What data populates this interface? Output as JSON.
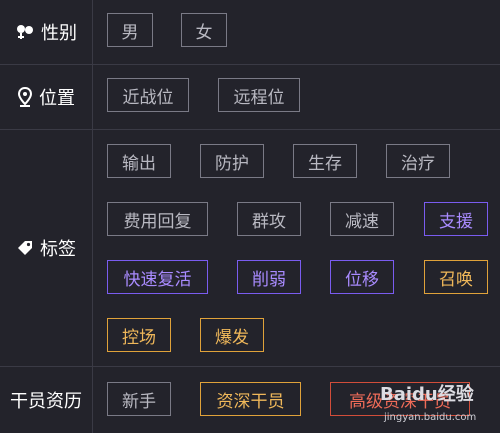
{
  "rows": {
    "gender": {
      "label": "性别",
      "icon": "gender-icon",
      "options": [
        "男",
        "女"
      ]
    },
    "position": {
      "label": "位置",
      "icon": "location-pin-icon",
      "options": [
        "近战位",
        "远程位"
      ]
    },
    "tags": {
      "label": "标签",
      "icon": "tag-icon",
      "options": [
        "输出",
        "防护",
        "生存",
        "治疗",
        "费用回复",
        "群攻",
        "减速",
        "支援",
        "快速复活",
        "削弱",
        "位移",
        "召唤",
        "控场",
        "爆发"
      ]
    },
    "seniority": {
      "label": "干员资历",
      "options": [
        "新手",
        "资深干员",
        "高级资深干员"
      ]
    }
  },
  "watermark": {
    "brand": "Baidu经验",
    "url": "jingyan.baidu.com"
  },
  "colors": {
    "background": "#23232b",
    "divider": "#3a3a45",
    "gray_tag": "#7a7a86",
    "purple_tag": "#7a5cf0",
    "orange_tag": "#e0a23a",
    "red_tag": "#d14d3a"
  }
}
